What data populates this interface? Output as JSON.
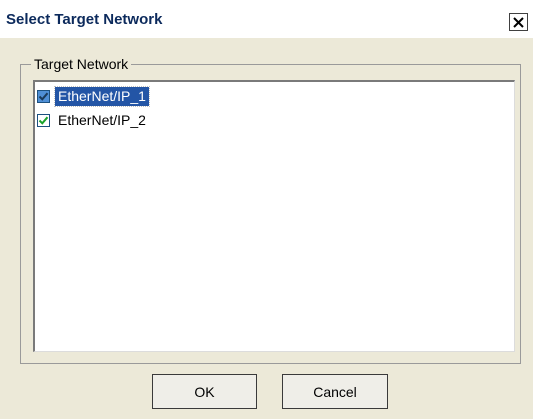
{
  "dialog": {
    "title": "Select Target Network",
    "close_glyph": "✕"
  },
  "group": {
    "label": "Target Network",
    "items": [
      {
        "label": "EtherNet/IP_1",
        "checked": true,
        "selected": true
      },
      {
        "label": "EtherNet/IP_2",
        "checked": true,
        "selected": false
      }
    ]
  },
  "buttons": {
    "ok_label": "OK",
    "cancel_label": "Cancel"
  },
  "colors": {
    "title_text": "#0c2a5c",
    "selection": "#2355a6",
    "checkmark": "#1aa32a",
    "dialog_bg": "#ece9d8"
  }
}
